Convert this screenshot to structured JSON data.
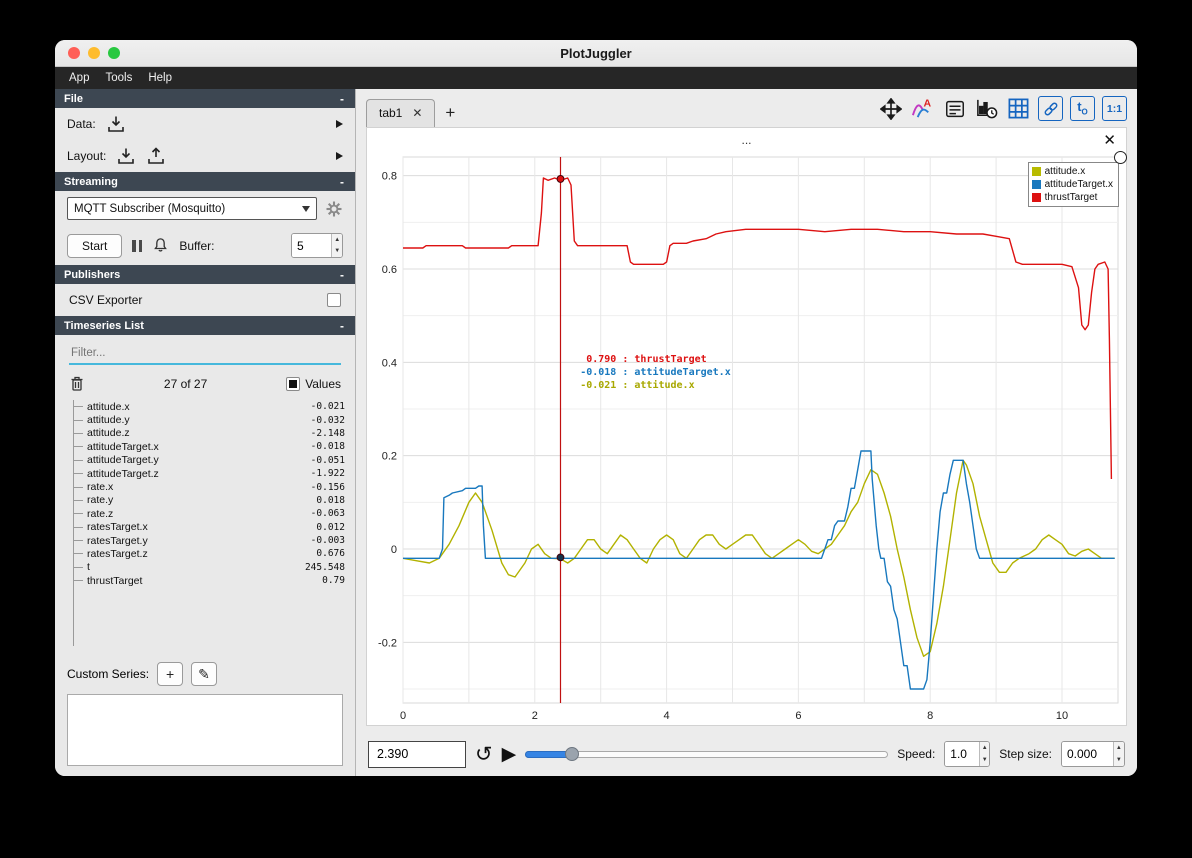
{
  "window": {
    "title": "PlotJuggler"
  },
  "menu": {
    "items": [
      {
        "label": "App"
      },
      {
        "label": "Tools"
      },
      {
        "label": "Help"
      }
    ]
  },
  "icons": {
    "close": "✕",
    "add": "+",
    "play": "▶",
    "loop": "↺",
    "pencil": "✎",
    "up": "▲",
    "down": "▼"
  },
  "sidebar": {
    "file": {
      "title": "File",
      "collapse": "-",
      "data_label": "Data:",
      "layout_label": "Layout:"
    },
    "streaming": {
      "title": "Streaming",
      "collapse": "-",
      "source": "MQTT Subscriber (Mosquitto)",
      "start_label": "Start",
      "buffer_label": "Buffer:",
      "buffer_value": "5"
    },
    "publishers": {
      "title": "Publishers",
      "collapse": "-",
      "csv_label": "CSV Exporter"
    },
    "timeseries": {
      "title": "Timeseries List",
      "collapse": "-",
      "filter_placeholder": "Filter...",
      "count": "27 of 27",
      "values_label": "Values",
      "custom_series_label": "Custom Series:",
      "items": [
        {
          "name": "attitude.x",
          "value": "-0.021"
        },
        {
          "name": "attitude.y",
          "value": "-0.032"
        },
        {
          "name": "attitude.z",
          "value": "-2.148"
        },
        {
          "name": "attitudeTarget.x",
          "value": "-0.018"
        },
        {
          "name": "attitudeTarget.y",
          "value": "-0.051"
        },
        {
          "name": "attitudeTarget.z",
          "value": "-1.922"
        },
        {
          "name": "rate.x",
          "value": "-0.156"
        },
        {
          "name": "rate.y",
          "value": "0.018"
        },
        {
          "name": "rate.z",
          "value": "-0.063"
        },
        {
          "name": "ratesTarget.x",
          "value": "0.012"
        },
        {
          "name": "ratesTarget.y",
          "value": "-0.003"
        },
        {
          "name": "ratesTarget.z",
          "value": "0.676"
        },
        {
          "name": "t",
          "value": "245.548"
        },
        {
          "name": "thrustTarget",
          "value": "0.79"
        }
      ]
    }
  },
  "main": {
    "tabs": [
      {
        "label": "tab1"
      }
    ],
    "toolbar": {
      "t0_main": "t",
      "t0_sub": "O",
      "ratio": "1:1"
    },
    "plot": {
      "title": "...",
      "legend": [
        {
          "label": "attitude.x",
          "color": "#b8bb00"
        },
        {
          "label": "attitudeTarget.x",
          "color": "#1878be"
        },
        {
          "label": "thrustTarget",
          "color": "#dd1111"
        }
      ],
      "readouts": [
        {
          "value": "0.790",
          "series": "thrustTarget",
          "color": "#dd1111"
        },
        {
          "value": "-0.018",
          "series": "attitudeTarget.x",
          "color": "#1878be"
        },
        {
          "value": "-0.021",
          "series": "attitude.x",
          "color": "#a8a800"
        }
      ]
    },
    "controls": {
      "time_value": "2.390",
      "speed_label": "Speed:",
      "speed_value": "1.0",
      "step_label": "Step size:",
      "step_value": "0.000"
    }
  },
  "chart_data": {
    "type": "line",
    "title": "...",
    "xlim": [
      0,
      10.85
    ],
    "ylim": [
      -0.33,
      0.84
    ],
    "xticks": [
      0,
      2,
      4,
      6,
      8,
      10
    ],
    "yticks": [
      -0.2,
      0,
      0.2,
      0.4,
      0.6,
      0.8
    ],
    "grid": true,
    "legend_position": "top-right",
    "tracker_x": 2.39,
    "tracker_points": [
      {
        "y": 0.793,
        "color": "#dd1111"
      },
      {
        "y": -0.018,
        "color": "#16324a"
      }
    ],
    "series": [
      {
        "name": "attitude.x",
        "color": "#b2b200",
        "points": [
          [
            0,
            -0.02
          ],
          [
            0.2,
            -0.025
          ],
          [
            0.4,
            -0.03
          ],
          [
            0.55,
            -0.02
          ],
          [
            0.7,
            0.01
          ],
          [
            0.85,
            0.05
          ],
          [
            1.0,
            0.1
          ],
          [
            1.1,
            0.12
          ],
          [
            1.2,
            0.1
          ],
          [
            1.35,
            0.04
          ],
          [
            1.5,
            -0.03
          ],
          [
            1.6,
            -0.055
          ],
          [
            1.7,
            -0.06
          ],
          [
            1.85,
            -0.03
          ],
          [
            1.95,
            0.0
          ],
          [
            2.05,
            0.01
          ],
          [
            2.15,
            -0.01
          ],
          [
            2.25,
            -0.02
          ],
          [
            2.39,
            -0.021
          ],
          [
            2.5,
            -0.03
          ],
          [
            2.6,
            -0.02
          ],
          [
            2.7,
            0.0
          ],
          [
            2.8,
            0.02
          ],
          [
            2.9,
            0.02
          ],
          [
            3.0,
            0.0
          ],
          [
            3.1,
            -0.01
          ],
          [
            3.2,
            0.01
          ],
          [
            3.3,
            0.03
          ],
          [
            3.4,
            0.02
          ],
          [
            3.5,
            0.0
          ],
          [
            3.6,
            -0.02
          ],
          [
            3.7,
            -0.03
          ],
          [
            3.8,
            0.0
          ],
          [
            3.9,
            0.02
          ],
          [
            4.0,
            0.03
          ],
          [
            4.1,
            0.02
          ],
          [
            4.2,
            -0.01
          ],
          [
            4.3,
            -0.02
          ],
          [
            4.4,
            0.0
          ],
          [
            4.5,
            0.02
          ],
          [
            4.6,
            0.03
          ],
          [
            4.7,
            0.03
          ],
          [
            4.8,
            0.01
          ],
          [
            4.9,
            0.0
          ],
          [
            5.0,
            0.01
          ],
          [
            5.1,
            0.02
          ],
          [
            5.2,
            0.03
          ],
          [
            5.3,
            0.03
          ],
          [
            5.4,
            0.01
          ],
          [
            5.5,
            -0.01
          ],
          [
            5.6,
            -0.02
          ],
          [
            5.7,
            -0.01
          ],
          [
            5.8,
            0.0
          ],
          [
            5.9,
            0.01
          ],
          [
            6.0,
            0.02
          ],
          [
            6.1,
            0.01
          ],
          [
            6.2,
            -0.005
          ],
          [
            6.3,
            -0.01
          ],
          [
            6.4,
            0.0
          ],
          [
            6.5,
            0.01
          ],
          [
            6.6,
            0.03
          ],
          [
            6.7,
            0.05
          ],
          [
            6.8,
            0.08
          ],
          [
            6.9,
            0.1
          ],
          [
            7.0,
            0.14
          ],
          [
            7.1,
            0.17
          ],
          [
            7.2,
            0.16
          ],
          [
            7.3,
            0.12
          ],
          [
            7.4,
            0.07
          ],
          [
            7.5,
            0.0
          ],
          [
            7.6,
            -0.06
          ],
          [
            7.7,
            -0.13
          ],
          [
            7.8,
            -0.19
          ],
          [
            7.9,
            -0.23
          ],
          [
            8.0,
            -0.22
          ],
          [
            8.1,
            -0.16
          ],
          [
            8.2,
            -0.08
          ],
          [
            8.3,
            0.02
          ],
          [
            8.4,
            0.12
          ],
          [
            8.5,
            0.19
          ],
          [
            8.55,
            0.18
          ],
          [
            8.65,
            0.14
          ],
          [
            8.75,
            0.07
          ],
          [
            8.85,
            0.02
          ],
          [
            8.95,
            -0.03
          ],
          [
            9.05,
            -0.05
          ],
          [
            9.15,
            -0.05
          ],
          [
            9.25,
            -0.03
          ],
          [
            9.35,
            -0.02
          ],
          [
            9.5,
            -0.01
          ],
          [
            9.6,
            0.0
          ],
          [
            9.7,
            0.02
          ],
          [
            9.8,
            0.03
          ],
          [
            9.9,
            0.02
          ],
          [
            10.0,
            0.01
          ],
          [
            10.1,
            -0.01
          ],
          [
            10.2,
            -0.015
          ],
          [
            10.3,
            -0.005
          ],
          [
            10.4,
            0.0
          ],
          [
            10.5,
            -0.01
          ],
          [
            10.6,
            -0.02
          ],
          [
            10.7,
            -0.02
          ],
          [
            10.8,
            -0.02
          ]
        ]
      },
      {
        "name": "attitudeTarget.x",
        "color": "#1878be",
        "points": [
          [
            0,
            -0.02
          ],
          [
            0.55,
            -0.02
          ],
          [
            0.6,
            0.0
          ],
          [
            0.62,
            0.11
          ],
          [
            0.7,
            0.115
          ],
          [
            0.75,
            0.12
          ],
          [
            0.9,
            0.125
          ],
          [
            0.95,
            0.13
          ],
          [
            1.1,
            0.13
          ],
          [
            1.15,
            0.135
          ],
          [
            1.2,
            0.135
          ],
          [
            1.22,
            0.05
          ],
          [
            1.25,
            -0.02
          ],
          [
            6.35,
            -0.02
          ],
          [
            6.4,
            0.0
          ],
          [
            6.45,
            0.02
          ],
          [
            6.5,
            0.02
          ],
          [
            6.55,
            0.05
          ],
          [
            6.6,
            0.06
          ],
          [
            6.7,
            0.06
          ],
          [
            6.75,
            0.09
          ],
          [
            6.8,
            0.13
          ],
          [
            6.85,
            0.13
          ],
          [
            6.9,
            0.17
          ],
          [
            6.95,
            0.21
          ],
          [
            7.1,
            0.21
          ],
          [
            7.12,
            0.15
          ],
          [
            7.15,
            0.1
          ],
          [
            7.18,
            0.05
          ],
          [
            7.22,
            0.0
          ],
          [
            7.25,
            -0.02
          ],
          [
            7.3,
            -0.02
          ],
          [
            7.35,
            -0.07
          ],
          [
            7.4,
            -0.08
          ],
          [
            7.45,
            -0.13
          ],
          [
            7.5,
            -0.15
          ],
          [
            7.55,
            -0.2
          ],
          [
            7.6,
            -0.25
          ],
          [
            7.65,
            -0.25
          ],
          [
            7.7,
            -0.3
          ],
          [
            7.9,
            -0.3
          ],
          [
            7.95,
            -0.28
          ],
          [
            8.0,
            -0.2
          ],
          [
            8.05,
            -0.1
          ],
          [
            8.1,
            0.0
          ],
          [
            8.15,
            0.08
          ],
          [
            8.2,
            0.12
          ],
          [
            8.25,
            0.12
          ],
          [
            8.3,
            0.16
          ],
          [
            8.35,
            0.19
          ],
          [
            8.5,
            0.19
          ],
          [
            8.55,
            0.14
          ],
          [
            8.6,
            0.1
          ],
          [
            8.65,
            0.05
          ],
          [
            8.7,
            0.0
          ],
          [
            8.75,
            -0.02
          ],
          [
            10.8,
            -0.02
          ]
        ]
      },
      {
        "name": "thrustTarget",
        "color": "#dd1111",
        "points": [
          [
            0,
            0.645
          ],
          [
            0.3,
            0.645
          ],
          [
            0.35,
            0.65
          ],
          [
            0.9,
            0.65
          ],
          [
            0.95,
            0.645
          ],
          [
            1.6,
            0.645
          ],
          [
            1.65,
            0.65
          ],
          [
            2.05,
            0.65
          ],
          [
            2.1,
            0.72
          ],
          [
            2.13,
            0.795
          ],
          [
            2.2,
            0.79
          ],
          [
            2.3,
            0.795
          ],
          [
            2.39,
            0.79
          ],
          [
            2.5,
            0.795
          ],
          [
            2.55,
            0.78
          ],
          [
            2.6,
            0.66
          ],
          [
            2.65,
            0.65
          ],
          [
            3.4,
            0.65
          ],
          [
            3.45,
            0.615
          ],
          [
            3.5,
            0.61
          ],
          [
            3.95,
            0.61
          ],
          [
            4.0,
            0.615
          ],
          [
            4.05,
            0.65
          ],
          [
            4.1,
            0.655
          ],
          [
            4.3,
            0.655
          ],
          [
            4.4,
            0.66
          ],
          [
            4.6,
            0.665
          ],
          [
            4.75,
            0.675
          ],
          [
            4.9,
            0.68
          ],
          [
            5.2,
            0.685
          ],
          [
            5.6,
            0.685
          ],
          [
            6.0,
            0.685
          ],
          [
            6.4,
            0.68
          ],
          [
            6.8,
            0.685
          ],
          [
            7.2,
            0.685
          ],
          [
            7.6,
            0.68
          ],
          [
            8.0,
            0.68
          ],
          [
            8.4,
            0.675
          ],
          [
            8.8,
            0.675
          ],
          [
            9.0,
            0.67
          ],
          [
            9.2,
            0.665
          ],
          [
            9.25,
            0.64
          ],
          [
            9.3,
            0.615
          ],
          [
            9.4,
            0.61
          ],
          [
            10.0,
            0.61
          ],
          [
            10.15,
            0.605
          ],
          [
            10.25,
            0.56
          ],
          [
            10.3,
            0.48
          ],
          [
            10.35,
            0.47
          ],
          [
            10.4,
            0.48
          ],
          [
            10.45,
            0.55
          ],
          [
            10.5,
            0.6
          ],
          [
            10.55,
            0.61
          ],
          [
            10.65,
            0.615
          ],
          [
            10.7,
            0.6
          ],
          [
            10.72,
            0.45
          ],
          [
            10.75,
            0.15
          ]
        ]
      }
    ]
  }
}
